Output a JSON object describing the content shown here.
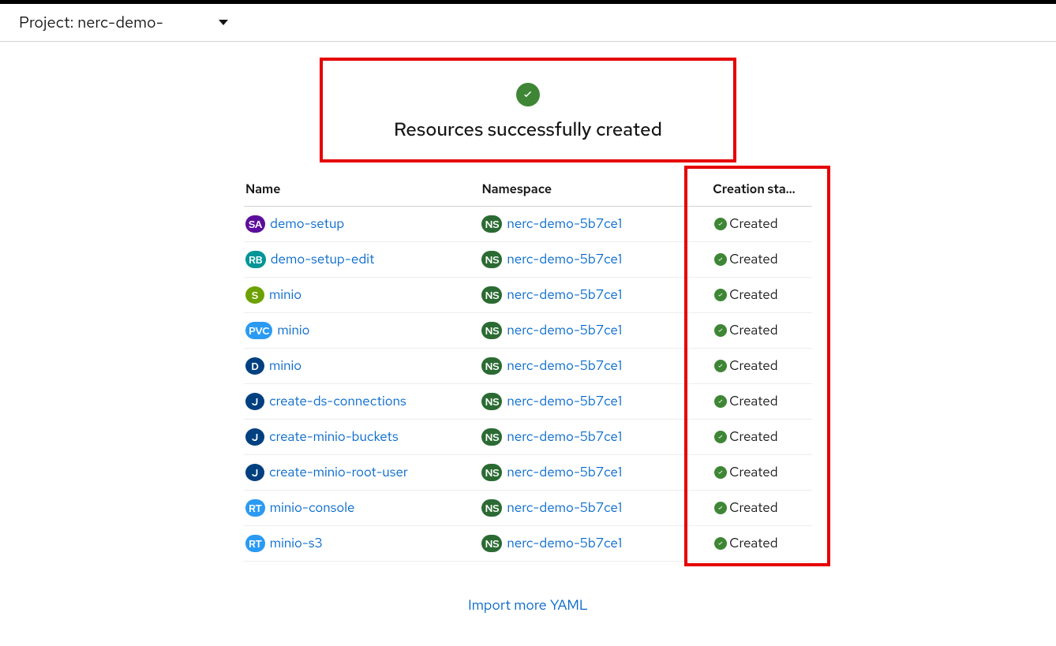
{
  "projectBar": {
    "label": "Project: nerc-demo-"
  },
  "banner": {
    "title": "Resources successfully created"
  },
  "table": {
    "headers": {
      "name": "Name",
      "namespace": "Namespace",
      "status": "Creation sta..."
    },
    "namespace_badge": "NS",
    "namespace_badge_color": "#2b6b33",
    "rows": [
      {
        "badge": "SA",
        "badge_color": "#5b0e9b",
        "badge_round": false,
        "name": "demo-setup",
        "namespace": "nerc-demo-5b7ce1",
        "status": "Created"
      },
      {
        "badge": "RB",
        "badge_color": "#009596",
        "badge_round": false,
        "name": "demo-setup-edit",
        "namespace": "nerc-demo-5b7ce1",
        "status": "Created"
      },
      {
        "badge": "S",
        "badge_color": "#6ca100",
        "badge_round": true,
        "name": "minio",
        "namespace": "nerc-demo-5b7ce1",
        "status": "Created"
      },
      {
        "badge": "PVC",
        "badge_color": "#2b9af3",
        "badge_round": false,
        "name": "minio",
        "namespace": "nerc-demo-5b7ce1",
        "status": "Created"
      },
      {
        "badge": "D",
        "badge_color": "#004080",
        "badge_round": true,
        "name": "minio",
        "namespace": "nerc-demo-5b7ce1",
        "status": "Created"
      },
      {
        "badge": "J",
        "badge_color": "#004080",
        "badge_round": true,
        "name": "create-ds-connections",
        "namespace": "nerc-demo-5b7ce1",
        "status": "Created"
      },
      {
        "badge": "J",
        "badge_color": "#004080",
        "badge_round": true,
        "name": "create-minio-buckets",
        "namespace": "nerc-demo-5b7ce1",
        "status": "Created"
      },
      {
        "badge": "J",
        "badge_color": "#004080",
        "badge_round": true,
        "name": "create-minio-root-user",
        "namespace": "nerc-demo-5b7ce1",
        "status": "Created"
      },
      {
        "badge": "RT",
        "badge_color": "#2b9af3",
        "badge_round": false,
        "name": "minio-console",
        "namespace": "nerc-demo-5b7ce1",
        "status": "Created"
      },
      {
        "badge": "RT",
        "badge_color": "#2b9af3",
        "badge_round": false,
        "name": "minio-s3",
        "namespace": "nerc-demo-5b7ce1",
        "status": "Created"
      }
    ]
  },
  "footer": {
    "import_more": "Import more YAML"
  }
}
